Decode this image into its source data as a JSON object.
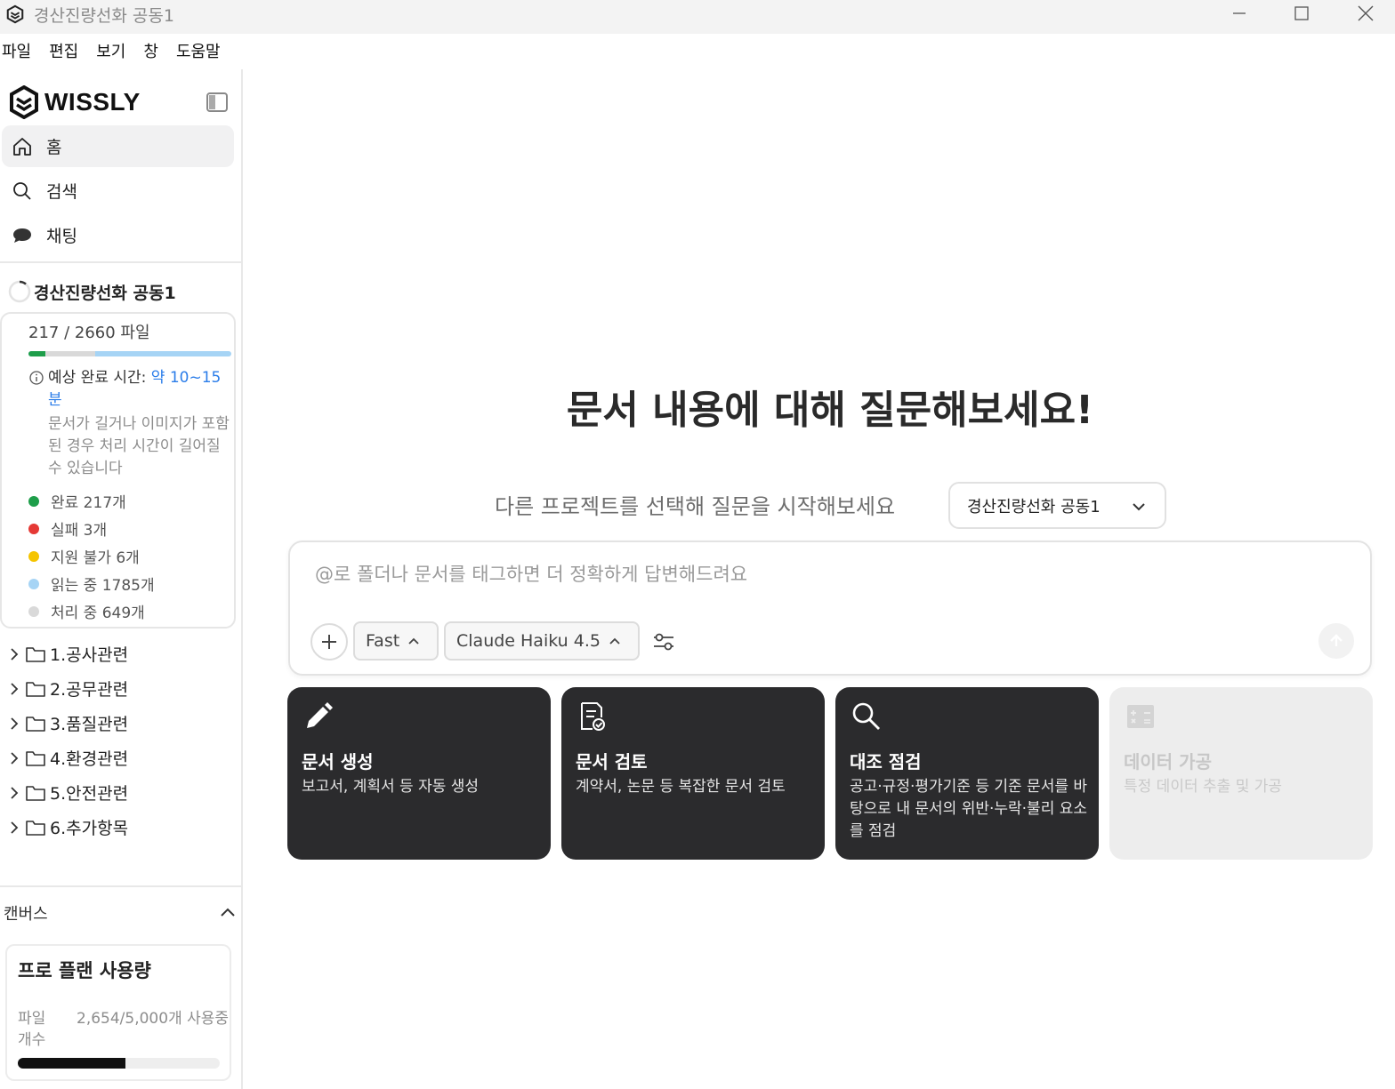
{
  "window": {
    "title": "경산진량선화 공동1"
  },
  "menu": [
    "파일",
    "편집",
    "보기",
    "창",
    "도움말"
  ],
  "sidebar": {
    "logo": "WISSLY",
    "nav": [
      {
        "label": "홈",
        "icon": "home-icon",
        "active": true
      },
      {
        "label": "검색",
        "icon": "search-icon",
        "active": false
      },
      {
        "label": "채팅",
        "icon": "chat-bubble-icon",
        "active": false
      }
    ],
    "project": {
      "name": "경산진량선화 공동1",
      "file_count": "217 / 2660 파일",
      "progress": {
        "done_fraction": 0.082,
        "fail_fraction": 0.0011,
        "reading_fraction": 0.671
      },
      "eta_label": "예상 완료 시간:",
      "eta_value": "약 10~15분",
      "eta_note": "문서가 길거나 이미지가 포함된 경우 처리 시간이 길어질 수 있습니다",
      "legend": [
        {
          "label": "완료 217개",
          "color": "#1e9e4a"
        },
        {
          "label": "실패 3개",
          "color": "#e53935"
        },
        {
          "label": "지원 불가 6개",
          "color": "#f5c400"
        },
        {
          "label": "읽는 중 1785개",
          "color": "#a6d4f5"
        },
        {
          "label": "처리 중 649개",
          "color": "#d9d9d9"
        }
      ]
    },
    "folders": [
      "1.공사관련",
      "2.공무관련",
      "3.품질관련",
      "4.환경관련",
      "5.안전관련",
      "6.추가항목"
    ],
    "canvas_label": "캔버스",
    "plan": {
      "title": "프로 플랜 사용량",
      "key": "파일 개수",
      "value": "2,654/5,000개 사용중",
      "usage_fraction": 0.531
    }
  },
  "main": {
    "heading": "문서 내용에 대해 질문해보세요!",
    "subline": "다른 프로젝트를 선택해 질문을 시작해보세요",
    "project_select": "경산진량선화 공동1",
    "prompt_placeholder": "@로 폴더나 문서를 태그하면 더 정확하게 답변해드려요",
    "mode": "Fast",
    "model": "Claude Haiku 4.5",
    "cards": [
      {
        "title": "문서 생성",
        "desc": "보고서, 계획서 등 자동 생성",
        "icon": "pencil-icon",
        "enabled": true
      },
      {
        "title": "문서 검토",
        "desc": "계약서, 논문 등 복잡한 문서 검토",
        "icon": "document-check-icon",
        "enabled": true
      },
      {
        "title": "대조 점검",
        "desc": "공고·규정·평가기준 등 기준 문서를 바탕으로 내 문서의 위반·누락·불리 요소를 점검",
        "icon": "magnifier-icon",
        "enabled": true
      },
      {
        "title": "데이터 가공",
        "desc": "특정 데이터 추출 및 가공",
        "icon": "calculator-icon",
        "enabled": false
      }
    ]
  }
}
